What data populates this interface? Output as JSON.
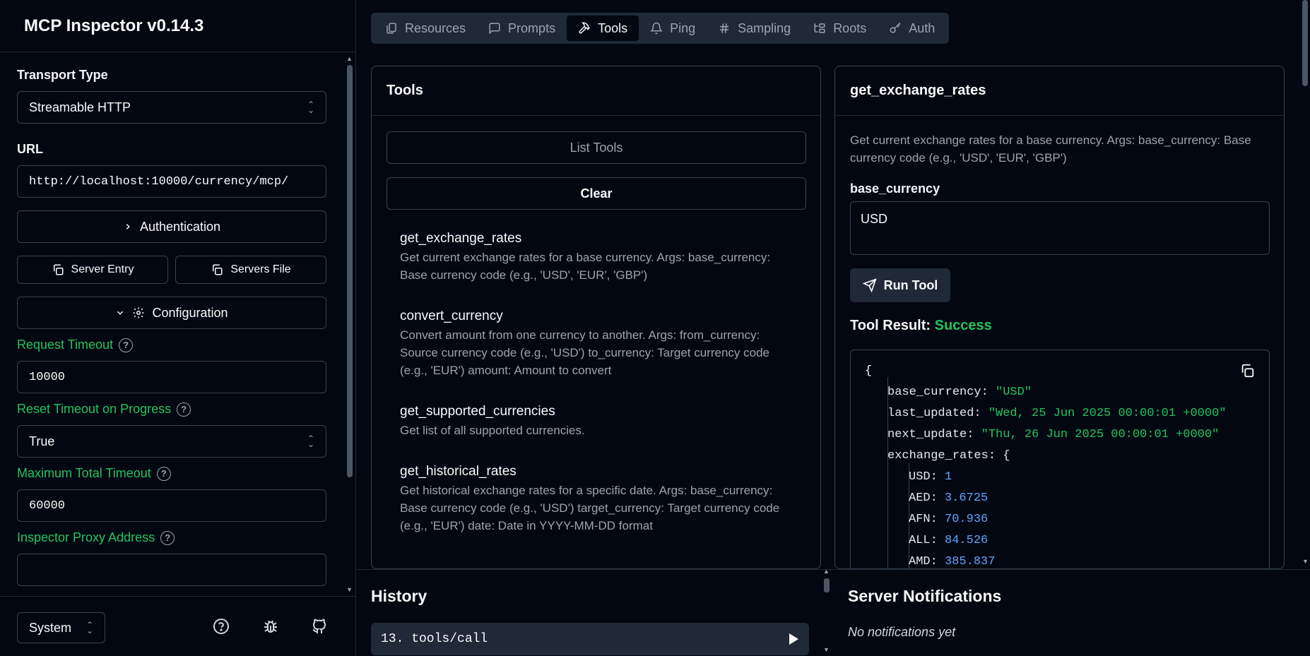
{
  "app": {
    "title": "MCP Inspector v0.14.3"
  },
  "sidebar": {
    "transport_label": "Transport Type",
    "transport_value": "Streamable HTTP",
    "url_label": "URL",
    "url_value": "http://localhost:10000/currency/mcp/",
    "auth_button": "Authentication",
    "server_entry_button": "Server Entry",
    "servers_file_button": "Servers File",
    "config_button": "Configuration",
    "request_timeout_label": "Request Timeout",
    "request_timeout_value": "10000",
    "reset_timeout_label": "Reset Timeout on Progress",
    "reset_timeout_value": "True",
    "max_timeout_label": "Maximum Total Timeout",
    "max_timeout_value": "60000",
    "proxy_label": "Inspector Proxy Address",
    "proxy_value": "",
    "theme_value": "System"
  },
  "tabs": [
    {
      "label": "Resources",
      "icon": "files-icon"
    },
    {
      "label": "Prompts",
      "icon": "message-icon"
    },
    {
      "label": "Tools",
      "icon": "hammer-icon",
      "active": true
    },
    {
      "label": "Ping",
      "icon": "bell-icon"
    },
    {
      "label": "Sampling",
      "icon": "hash-icon"
    },
    {
      "label": "Roots",
      "icon": "folder-tree-icon"
    },
    {
      "label": "Auth",
      "icon": "key-icon"
    }
  ],
  "tools_panel": {
    "title": "Tools",
    "list_button": "List Tools",
    "clear_button": "Clear",
    "items": [
      {
        "name": "get_exchange_rates",
        "desc": "Get current exchange rates for a base currency. Args: base_currency: Base currency code (e.g., 'USD', 'EUR', 'GBP')"
      },
      {
        "name": "convert_currency",
        "desc": "Convert amount from one currency to another. Args: from_currency: Source currency code (e.g., 'USD') to_currency: Target currency code (e.g., 'EUR') amount: Amount to convert"
      },
      {
        "name": "get_supported_currencies",
        "desc": "Get list of all supported currencies."
      },
      {
        "name": "get_historical_rates",
        "desc": "Get historical exchange rates for a specific date. Args: base_currency: Base currency code (e.g., 'USD') target_currency: Target currency code (e.g., 'EUR') date: Date in YYYY-MM-DD format"
      }
    ]
  },
  "detail_panel": {
    "title": "get_exchange_rates",
    "description": "Get current exchange rates for a base currency. Args: base_currency: Base currency code (e.g., 'USD', 'EUR', 'GBP')",
    "param_label": "base_currency",
    "param_value": "USD",
    "run_button": "Run Tool",
    "result_label": "Tool Result:",
    "result_status": "Success",
    "result_json": {
      "open_brace": "{",
      "base_currency_key": "base_currency:",
      "base_currency_val": "\"USD\"",
      "last_updated_key": "last_updated:",
      "last_updated_val": "\"Wed, 25 Jun 2025 00:00:01 +0000\"",
      "next_update_key": "next_update:",
      "next_update_val": "\"Thu, 26 Jun 2025 00:00:01 +0000\"",
      "exchange_rates_key": "exchange_rates:",
      "exchange_rates_open": "{",
      "rates": [
        {
          "code": "USD:",
          "value": "1"
        },
        {
          "code": "AED:",
          "value": "3.6725"
        },
        {
          "code": "AFN:",
          "value": "70.936"
        },
        {
          "code": "ALL:",
          "value": "84.526"
        },
        {
          "code": "AMD:",
          "value": "385.837"
        }
      ]
    }
  },
  "history": {
    "title": "History",
    "entries": [
      {
        "label": "13. tools/call"
      }
    ]
  },
  "notifications": {
    "title": "Server Notifications",
    "empty_text": "No notifications yet"
  }
}
